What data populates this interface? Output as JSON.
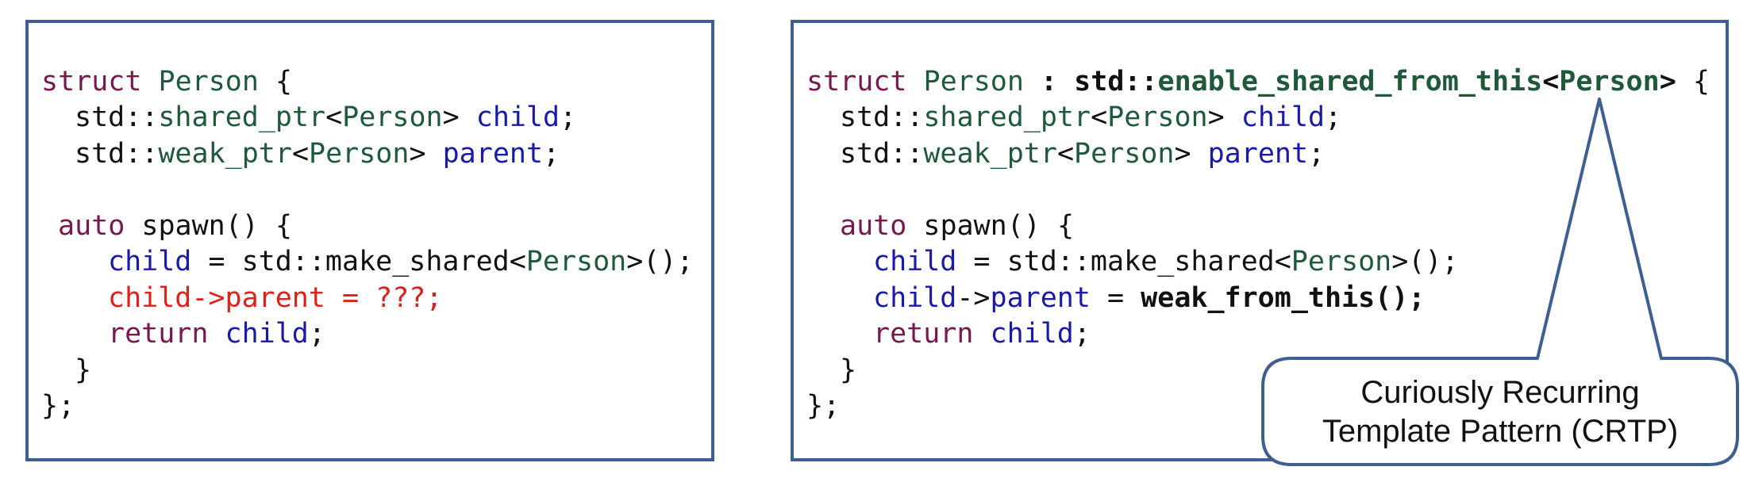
{
  "left_code": {
    "l1": {
      "kw": "struct",
      "name": "Person",
      "brace": "{"
    },
    "l2": {
      "ns": "std::",
      "type": "shared_ptr",
      "lt": "<",
      "arg": "Person",
      "gt": ">",
      "member": "child",
      "semi": ";"
    },
    "l3": {
      "ns": "std::",
      "type": "weak_ptr",
      "lt": "<",
      "arg": "Person",
      "gt": ">",
      "member": "parent",
      "semi": ";"
    },
    "l4": {
      "kw": "auto",
      "rest": "spawn() {"
    },
    "l5": {
      "member": "child",
      "mid": " = std::make_shared<",
      "arg": "Person",
      "end": ">();"
    },
    "l6": {
      "text": "child->parent = ???;"
    },
    "l7": {
      "kw": "return",
      "member": "child",
      "semi": ";"
    },
    "l8": {
      "text": "}"
    },
    "l9": {
      "text": "};"
    }
  },
  "right_code": {
    "l1": {
      "kw": "struct",
      "name": "Person",
      "colon": " : ",
      "base_ns": "std::",
      "base": "enable_shared_from_this",
      "lt": "<",
      "arg": "Person",
      "gt": ">",
      "brace": "{"
    },
    "l2": {
      "ns": "std::",
      "type": "shared_ptr",
      "lt": "<",
      "arg": "Person",
      "gt": ">",
      "member": "child",
      "semi": ";"
    },
    "l3": {
      "ns": "std::",
      "type": "weak_ptr",
      "lt": "<",
      "arg": "Person",
      "gt": ">",
      "member": "parent",
      "semi": ";"
    },
    "l4": {
      "kw": "auto",
      "rest": "spawn() {"
    },
    "l5": {
      "member": "child",
      "mid": " = std::make_shared<",
      "arg": "Person",
      "end": ">();"
    },
    "l6": {
      "member1": "child",
      "arrow": "->",
      "member2": "parent",
      "eq": " = ",
      "call": "weak_from_this();"
    },
    "l7": {
      "kw": "return",
      "member": "child",
      "semi": ";"
    },
    "l8": {
      "text": "}"
    },
    "l9": {
      "text": "};"
    }
  },
  "callout": {
    "line1": "Curiously Recurring",
    "line2": "Template Pattern (CRTP)"
  },
  "colors": {
    "border": "#3d5f91",
    "keyword": "#7a1650",
    "type": "#1e5a3a",
    "member": "#1a1aa8",
    "error": "#e0201a",
    "text": "#111111"
  }
}
